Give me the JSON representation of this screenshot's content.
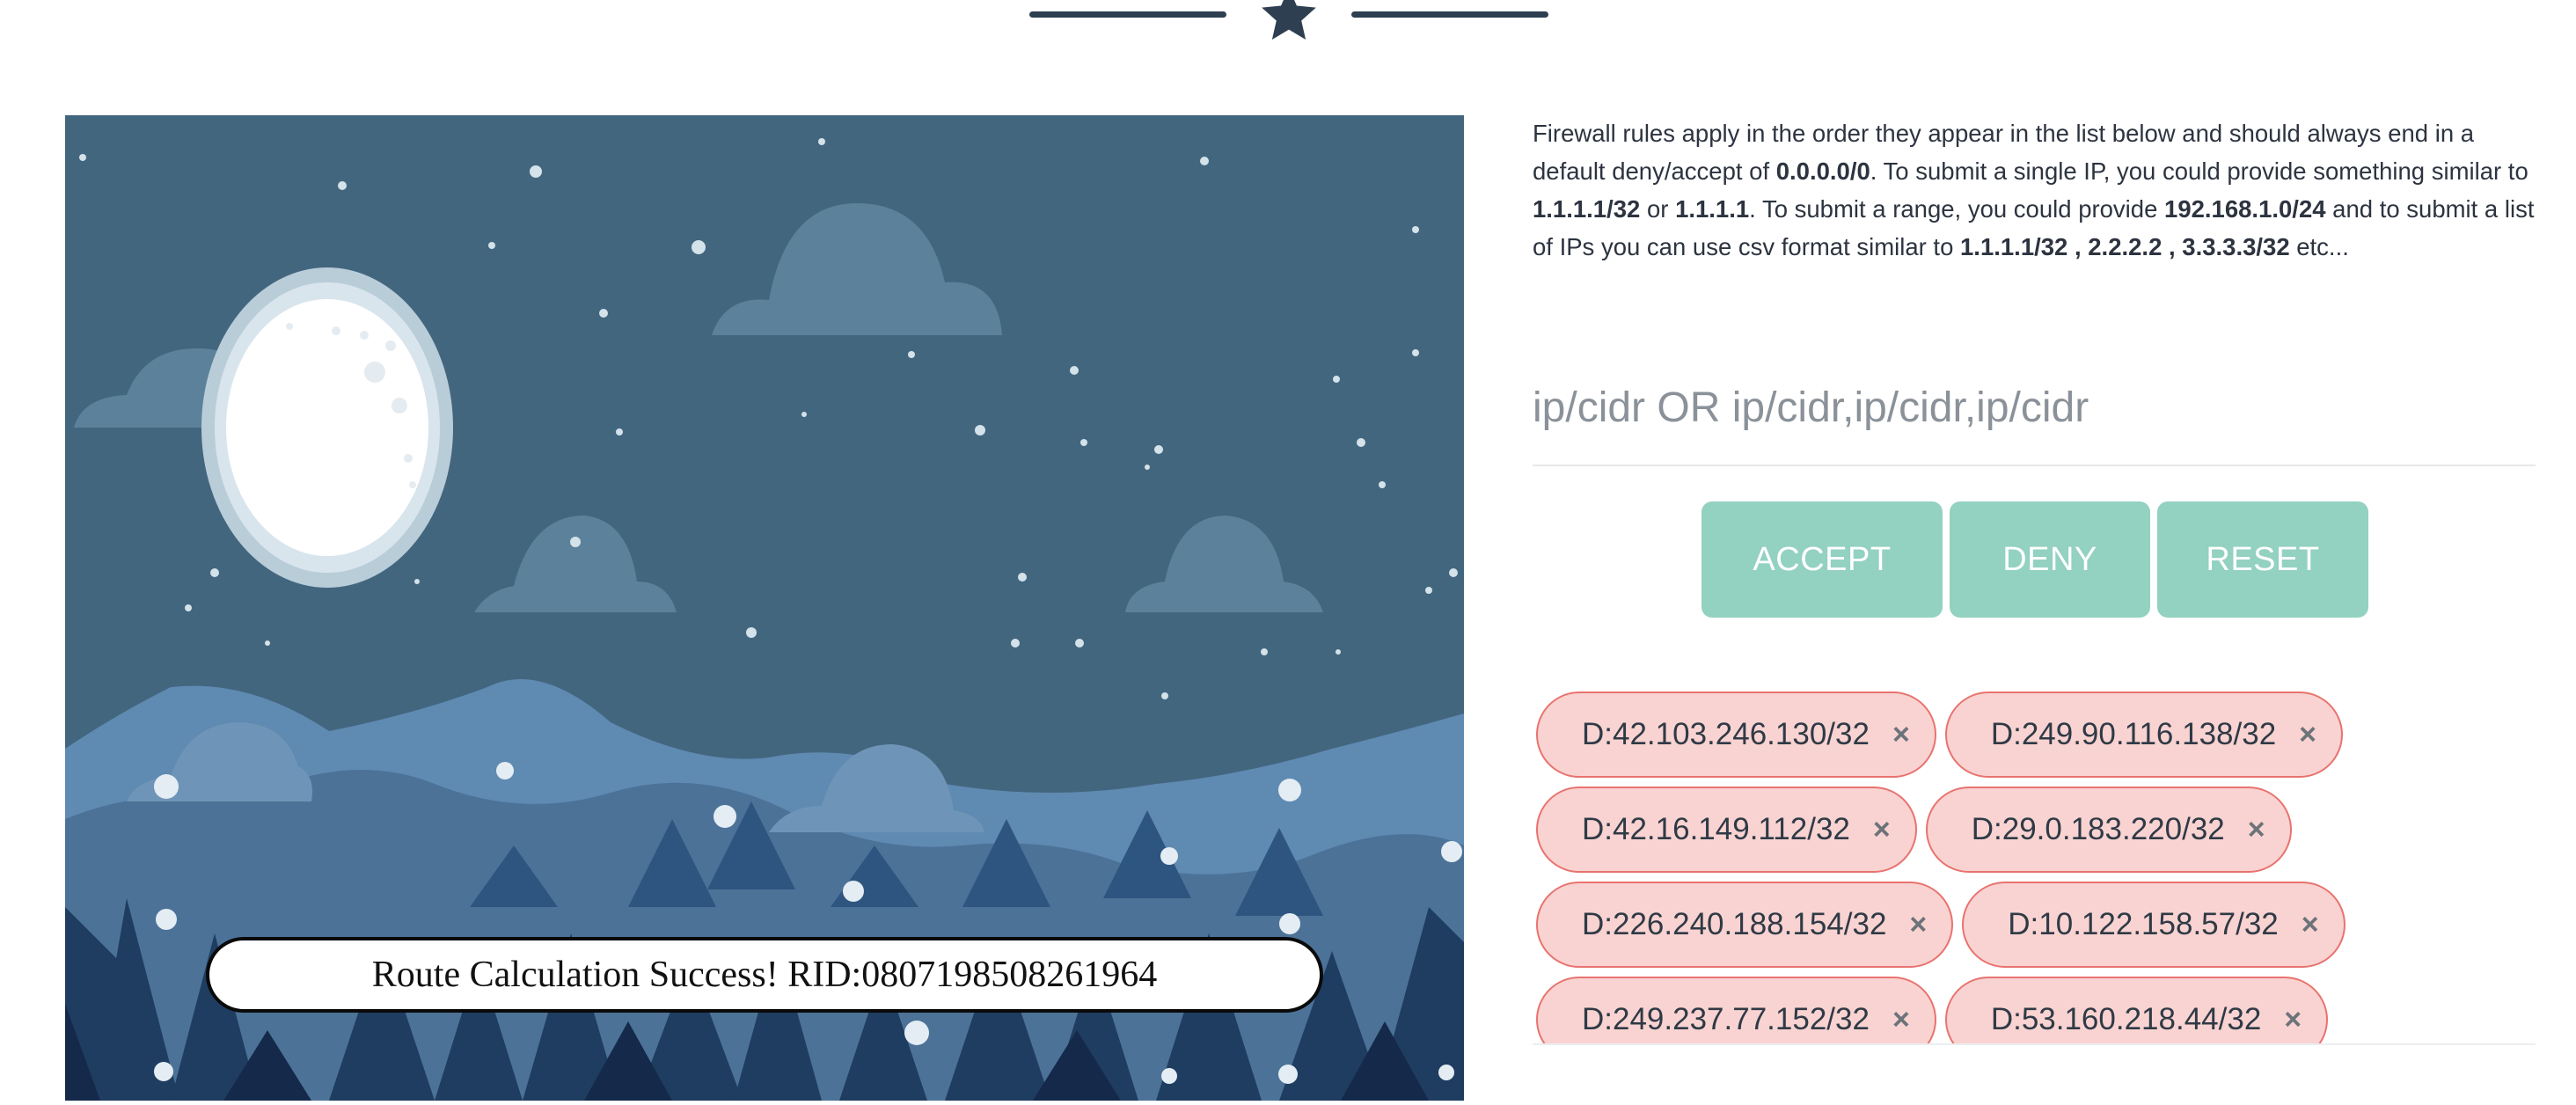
{
  "scene": {
    "route_message": "Route Calculation Success! RID:0807198508261964"
  },
  "panel": {
    "description_parts": [
      {
        "text": "Firewall rules apply in the order they appear in the list below and should always end in a default deny/accept of ",
        "bold": false
      },
      {
        "text": "0.0.0.0/0",
        "bold": true
      },
      {
        "text": ". To submit a single IP, you could provide something similar to ",
        "bold": false
      },
      {
        "text": "1.1.1.1/32",
        "bold": true
      },
      {
        "text": " or ",
        "bold": false
      },
      {
        "text": "1.1.1.1",
        "bold": true
      },
      {
        "text": ". To submit a range, you could provide ",
        "bold": false
      },
      {
        "text": "192.168.1.0/24",
        "bold": true
      },
      {
        "text": " and to submit a list of IPs you can use csv format similar to ",
        "bold": false
      },
      {
        "text": "1.1.1.1/32 , 2.2.2.2 , 3.3.3.3/32",
        "bold": true
      },
      {
        "text": " etc...",
        "bold": false
      }
    ],
    "input": {
      "placeholder": "ip/cidr OR ip/cidr,ip/cidr,ip/cidr",
      "value": ""
    },
    "buttons": {
      "accept": "ACCEPT",
      "deny": "DENY",
      "reset": "RESET"
    },
    "remove_glyph": "×",
    "rules": [
      [
        "D:42.103.246.130/32",
        "D:249.90.116.138/32"
      ],
      [
        "D:42.16.149.112/32",
        "D:29.0.183.220/32"
      ],
      [
        "D:226.240.188.154/32",
        "D:10.122.158.57/32"
      ],
      [
        "D:249.237.77.152/32",
        "D:53.160.218.44/32"
      ]
    ]
  },
  "colors": {
    "button_bg": "#93d1c0",
    "rule_bg": "#f9d3d1",
    "rule_border": "#e8736f",
    "divider": "#2f3f52",
    "sky": "#43667f"
  },
  "icons": {
    "divider_star": "star-icon",
    "remove": "close-icon"
  }
}
